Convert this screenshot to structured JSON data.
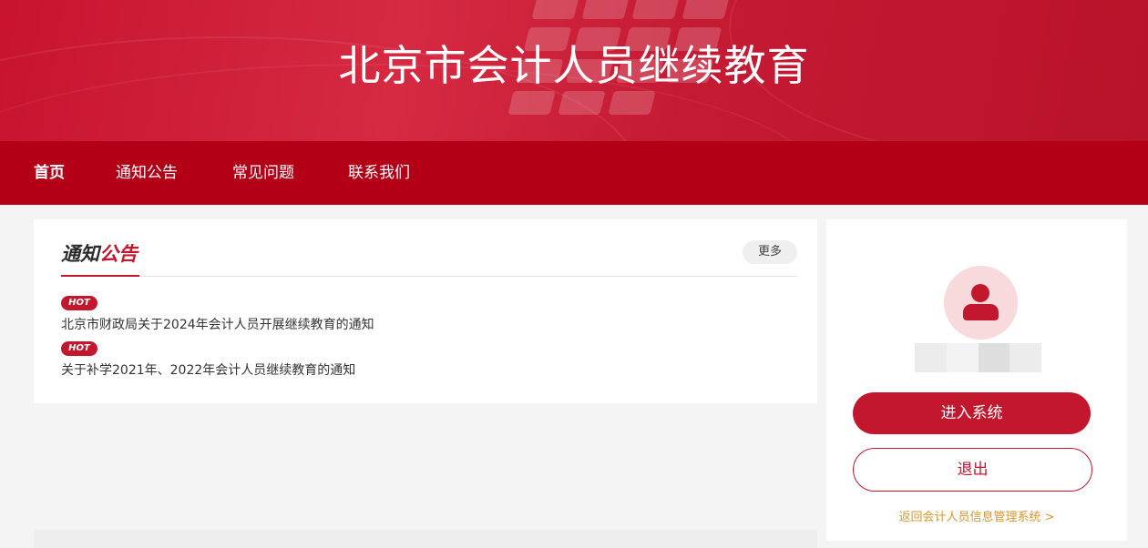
{
  "site": {
    "title": "北京市会计人员继续教育"
  },
  "nav": {
    "items": [
      {
        "label": "首页",
        "active": true
      },
      {
        "label": "通知公告",
        "active": false
      },
      {
        "label": "常见问题",
        "active": false
      },
      {
        "label": "联系我们",
        "active": false
      }
    ]
  },
  "notices": {
    "title_part1": "通知",
    "title_part2": "公告",
    "more_label": "更多",
    "items": [
      {
        "badge": "HOT",
        "text": "北京市财政局关于2024年会计人员开展继续教育的通知"
      },
      {
        "badge": "HOT",
        "text": "关于补学2021年、2022年会计人员继续教育的通知"
      }
    ]
  },
  "user_card": {
    "avatar_icon": "user-icon",
    "enter_label": "进入系统",
    "logout_label": "退出",
    "return_link": "返回会计人员信息管理系统 >"
  },
  "colors": {
    "brand_red": "#c3172e",
    "nav_red": "#b30016",
    "link_gold": "#d9952d"
  }
}
